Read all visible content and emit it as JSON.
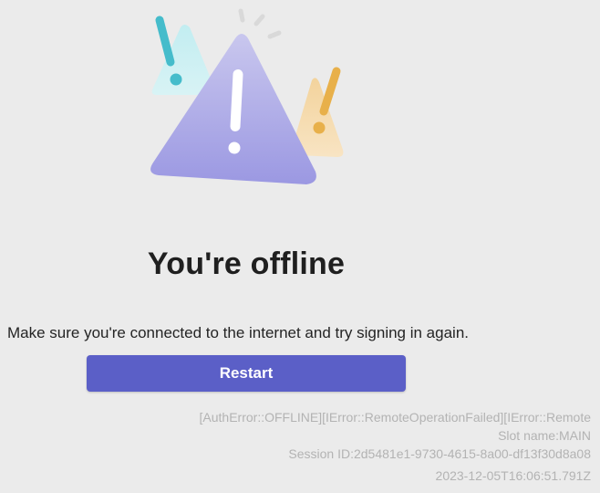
{
  "page": {
    "title": "You're offline",
    "message": "Make sure you're connected to the internet and try signing in again.",
    "restart_label": "Restart"
  },
  "diagnostics": {
    "error_code": "[AuthError::OFFLINE][IError::RemoteOperationFailed][IError::Remote",
    "slot_name": "Slot name:MAIN",
    "session_id": "Session ID:2d5481e1-9730-4615-8a00-df13f30d8a08",
    "timestamp": "2023-12-05T16:06:51.791Z"
  },
  "illustration": {
    "icon": "warning-triangles-illustration",
    "colors": {
      "main_triangle": "#a8a6e6",
      "left_triangle": "#c6eef2",
      "right_triangle": "#f7ddb0",
      "left_accent": "#45bccb",
      "right_accent": "#e8b04a",
      "sparkle": "#d9d9d9"
    }
  },
  "colors": {
    "background": "#ebebeb",
    "button": "#5b5fc7",
    "title_text": "#1f1f1f",
    "diagnostic_text": "#b3b3b3"
  }
}
